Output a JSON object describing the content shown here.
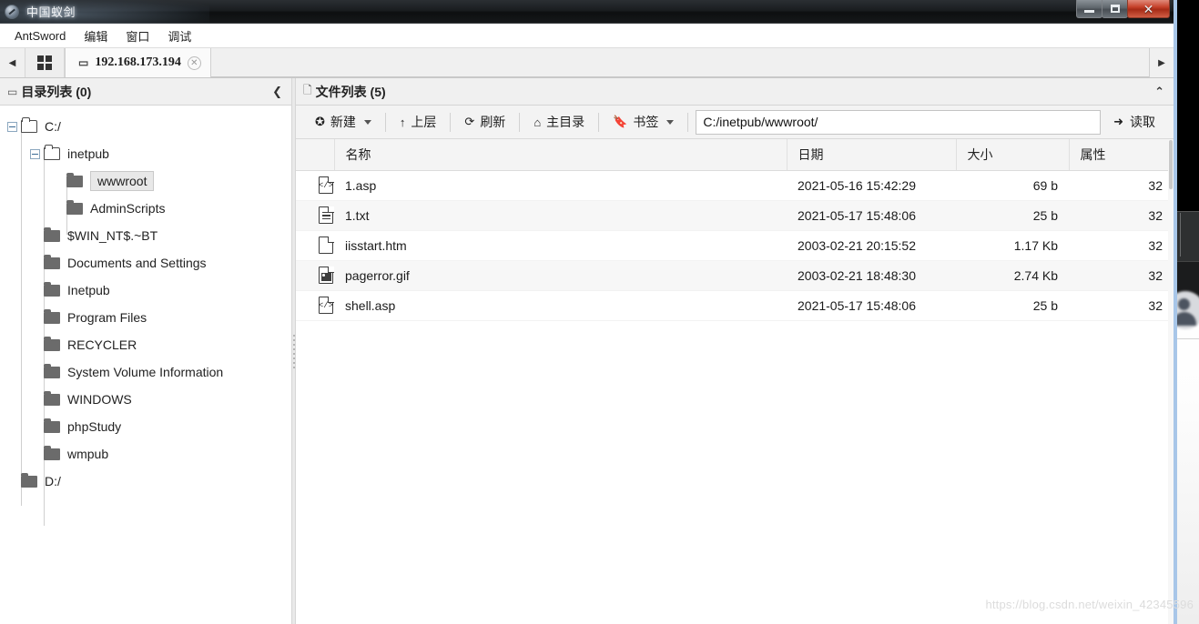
{
  "window": {
    "title": "中国蚁剑",
    "app_icon": "compass-icon",
    "buttons": {
      "minimize": "—",
      "maximize": "❐",
      "close": "✕"
    }
  },
  "menubar": {
    "items": [
      {
        "label": "AntSword"
      },
      {
        "label": "编辑"
      },
      {
        "label": "窗口"
      },
      {
        "label": "调试"
      }
    ]
  },
  "tabbar": {
    "prev_arrow": "◀",
    "next_arrow": "▶",
    "grid_button": "grid-icon",
    "tabs": [
      {
        "label": "192.168.173.194",
        "folder_icon": "▭",
        "close": "✕",
        "active": true
      }
    ]
  },
  "left_panel": {
    "icon": "folder-icon",
    "title": "目录列表 (0)",
    "collapse_chevron": "❮",
    "tree": [
      {
        "label": "C:/",
        "depth": 0,
        "type": "open",
        "expanded": true,
        "selected": false
      },
      {
        "label": "inetpub",
        "depth": 1,
        "type": "open",
        "expanded": true,
        "selected": false
      },
      {
        "label": "wwwroot",
        "depth": 2,
        "type": "solid",
        "expanded": null,
        "selected": true
      },
      {
        "label": "AdminScripts",
        "depth": 2,
        "type": "solid",
        "expanded": null,
        "selected": false
      },
      {
        "label": "$WIN_NT$.~BT",
        "depth": 1,
        "type": "solid",
        "expanded": null,
        "selected": false
      },
      {
        "label": "Documents and Settings",
        "depth": 1,
        "type": "solid",
        "expanded": null,
        "selected": false
      },
      {
        "label": "Inetpub",
        "depth": 1,
        "type": "solid",
        "expanded": null,
        "selected": false
      },
      {
        "label": "Program Files",
        "depth": 1,
        "type": "solid",
        "expanded": null,
        "selected": false
      },
      {
        "label": "RECYCLER",
        "depth": 1,
        "type": "solid",
        "expanded": null,
        "selected": false
      },
      {
        "label": "System Volume Information",
        "depth": 1,
        "type": "solid",
        "expanded": null,
        "selected": false
      },
      {
        "label": "WINDOWS",
        "depth": 1,
        "type": "solid",
        "expanded": null,
        "selected": false
      },
      {
        "label": "phpStudy",
        "depth": 1,
        "type": "solid",
        "expanded": null,
        "selected": false
      },
      {
        "label": "wmpub",
        "depth": 1,
        "type": "solid",
        "expanded": null,
        "selected": false
      },
      {
        "label": "D:/",
        "depth": 0,
        "type": "solid",
        "expanded": null,
        "selected": false
      }
    ]
  },
  "right_panel": {
    "icon": "file-icon",
    "title": "文件列表 (5)",
    "collapse_chevron": "⌃",
    "toolbar": {
      "new_label": "新建",
      "new_icon": "plus-circle-icon",
      "up_label": "上层",
      "up_icon": "arrow-up-icon",
      "refresh_label": "刷新",
      "refresh_icon": "refresh-icon",
      "home_label": "主目录",
      "home_icon": "home-icon",
      "bookmark_label": "书签",
      "bookmark_icon": "bookmark-icon",
      "path_value": "C:/inetpub/wwwroot/",
      "path_placeholder": "C:/inetpub/wwwroot/",
      "read_label": "读取",
      "read_icon": "arrow-right-icon"
    },
    "table": {
      "headers": {
        "name": "名称",
        "date": "日期",
        "size": "大小",
        "attr": "属性"
      },
      "rows": [
        {
          "name": "1.asp",
          "date": "2021-05-16 15:42:29",
          "size": "69 b",
          "attr": "32",
          "icon": "code-file-icon"
        },
        {
          "name": "1.txt",
          "date": "2021-05-17 15:48:06",
          "size": "25 b",
          "attr": "32",
          "icon": "text-file-icon"
        },
        {
          "name": "iisstart.htm",
          "date": "2003-02-21 20:15:52",
          "size": "1.17 Kb",
          "attr": "32",
          "icon": "blank-file-icon"
        },
        {
          "name": "pagerror.gif",
          "date": "2003-02-21 18:48:30",
          "size": "2.74 Kb",
          "attr": "32",
          "icon": "image-file-icon"
        },
        {
          "name": "shell.asp",
          "date": "2021-05-17 15:48:06",
          "size": "25 b",
          "attr": "32",
          "icon": "code-file-icon"
        }
      ]
    }
  },
  "watermark": {
    "text": "https://blog.csdn.net/weixin_42345596"
  }
}
